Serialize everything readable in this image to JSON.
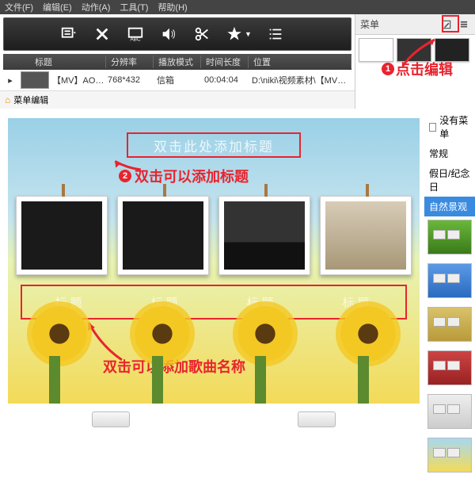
{
  "menubar": {
    "file": "文件(F)",
    "edit": "编辑(E)",
    "action": "动作(A)",
    "tools": "工具(T)",
    "help": "帮助(H)"
  },
  "columns": {
    "title": "标题",
    "resolution": "分辨率",
    "playmode": "播放模式",
    "duration": "时间长度",
    "location": "位置"
  },
  "file": {
    "title": "【MV】AOA ...",
    "resolution": "768*432",
    "playmode": "信箱",
    "duration": "00:04:04",
    "location": "D:\\niki\\视频素材\\【MV】AOA - 动摇..."
  },
  "breadcrumb": {
    "label": "菜单编辑"
  },
  "panel": {
    "title": "菜单"
  },
  "annotations": {
    "edit": "点击编辑",
    "title_hint": "双击可以添加标题",
    "song_hint": "双击可以添加歌曲名称",
    "badge1": "1",
    "badge2": "2"
  },
  "preview": {
    "title_placeholder": "双击此处添加标题",
    "song_labels": [
      "标题",
      "标题",
      "标题",
      "标题"
    ]
  },
  "sidebar": {
    "no_menu": "没有菜单",
    "general": "常规",
    "holiday": "假日/纪念日",
    "scenery": "自然景观"
  },
  "bottom": {
    "btn1": " ",
    "btn2": " "
  }
}
